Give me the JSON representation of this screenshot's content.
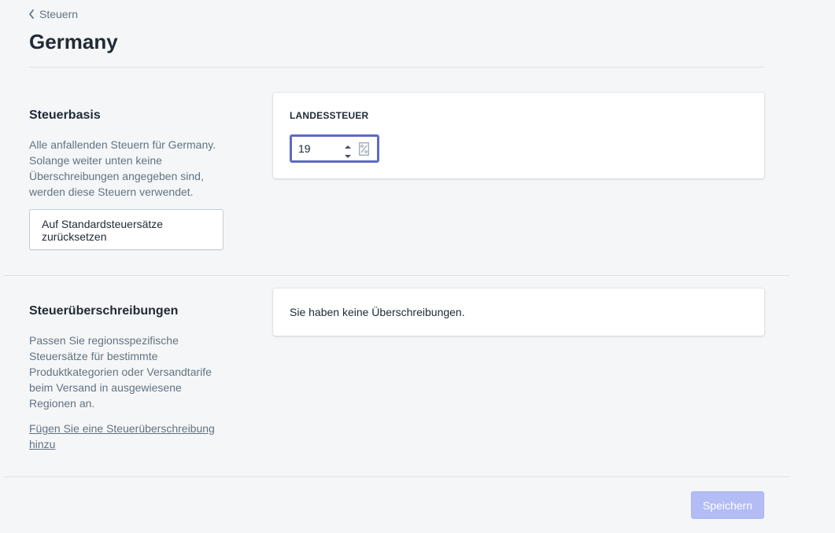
{
  "breadcrumb": {
    "label": "Steuern"
  },
  "page": {
    "title": "Germany"
  },
  "tax_basis": {
    "heading": "Steuerbasis",
    "description": "Alle anfallenden Steuern für Germany. Solange weiter unten keine Überschreibungen angegeben sind, werden diese Steuern verwendet.",
    "reset_button_label": "Auf Standardsteuersätze zurücksetzen"
  },
  "country_tax_card": {
    "label": "LANDESSTEUER",
    "rate_value": "19",
    "unit_icon": "percent-icon"
  },
  "overrides": {
    "heading": "Steuerüberschreibungen",
    "description": "Passen Sie regionsspezifische Steuersätze für bestimmte Produktkategorien oder Versandtarife beim Versand in ausgewiesene Regionen an.",
    "add_link_label": "Fügen Sie eine Steuerüberschreibung hinzu",
    "empty_text": "Sie haben keine Überschreibungen."
  },
  "footer": {
    "save_label": "Speichern"
  },
  "colors": {
    "focus": "#5c6ac4",
    "save_disabled": "#b3bcf5",
    "muted_text": "#637381",
    "text": "#212b36"
  }
}
